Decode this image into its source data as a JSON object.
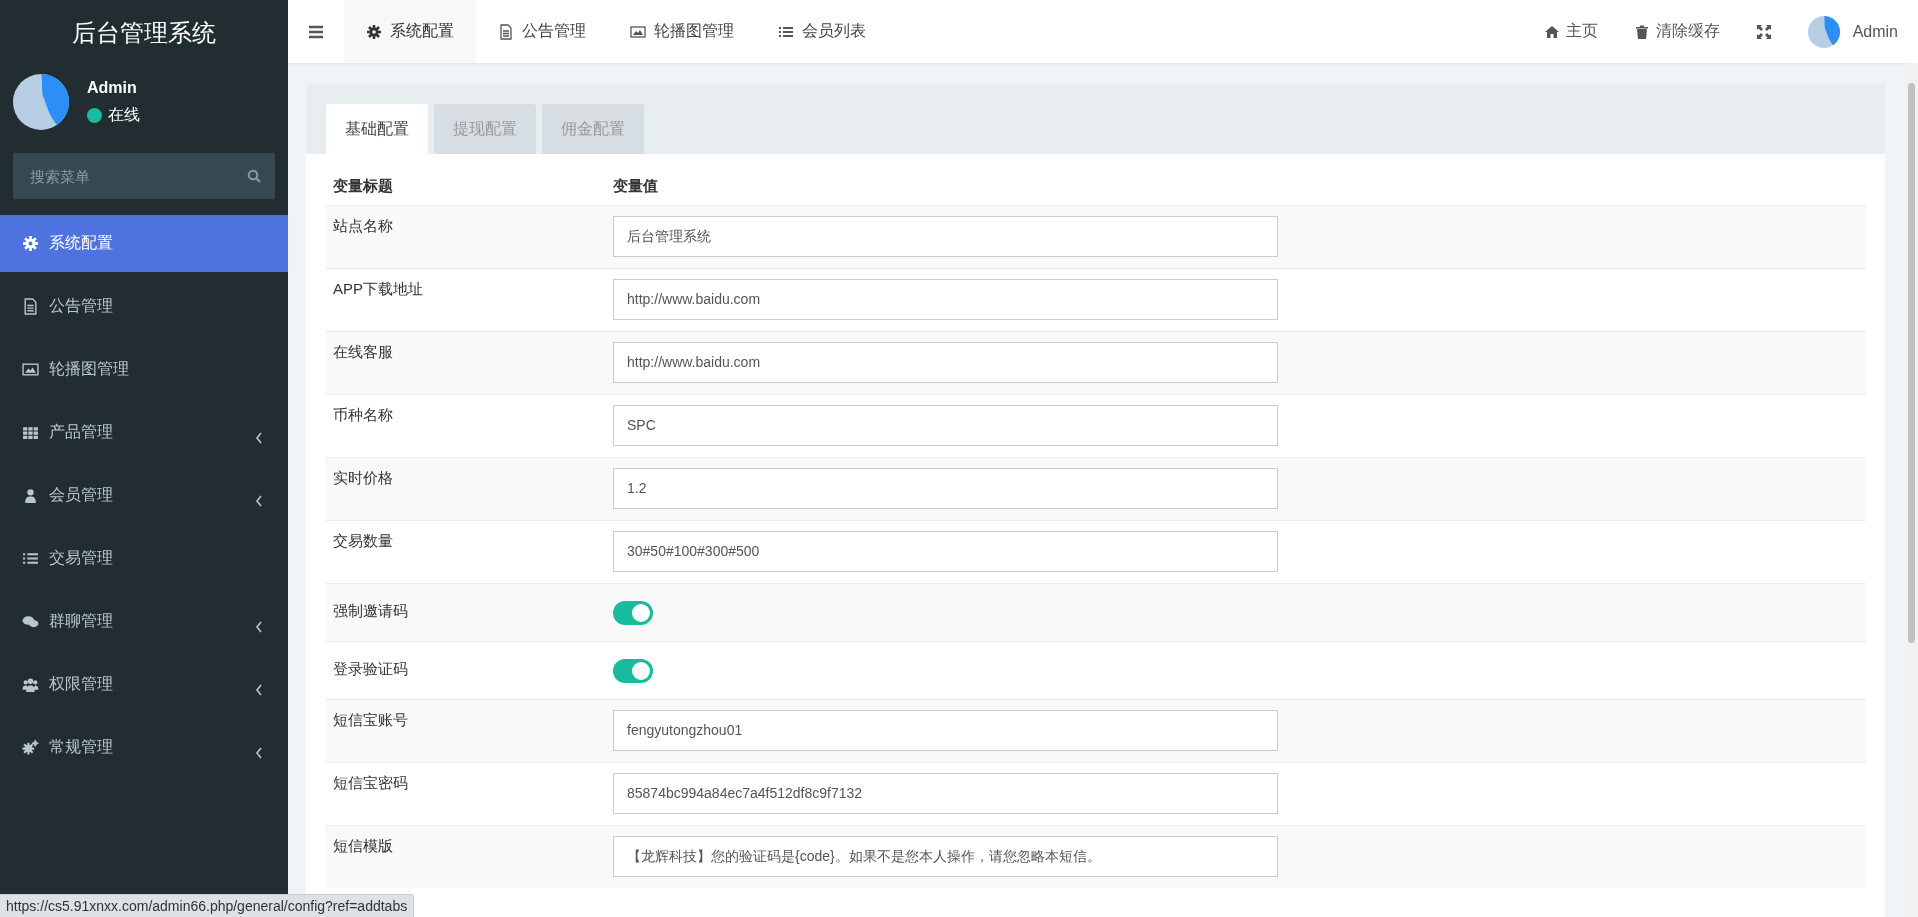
{
  "sidebar": {
    "title": "后台管理系统",
    "user": {
      "name": "Admin",
      "status": "在线"
    },
    "search": {
      "placeholder": "搜索菜单"
    },
    "items": [
      {
        "label": "系统配置",
        "selected": true,
        "has_submenu": false
      },
      {
        "label": "公告管理",
        "selected": false,
        "has_submenu": false
      },
      {
        "label": "轮播图管理",
        "selected": false,
        "has_submenu": false
      },
      {
        "label": "产品管理",
        "selected": false,
        "has_submenu": true
      },
      {
        "label": "会员管理",
        "selected": false,
        "has_submenu": true
      },
      {
        "label": "交易管理",
        "selected": false,
        "has_submenu": false
      },
      {
        "label": "群聊管理",
        "selected": false,
        "has_submenu": true
      },
      {
        "label": "权限管理",
        "selected": false,
        "has_submenu": true
      },
      {
        "label": "常规管理",
        "selected": false,
        "has_submenu": true
      }
    ]
  },
  "top_tabs": [
    {
      "label": "系统配置",
      "selected": true
    },
    {
      "label": "公告管理",
      "selected": false
    },
    {
      "label": "轮播图管理",
      "selected": false
    },
    {
      "label": "会员列表",
      "selected": false
    }
  ],
  "top_right": {
    "home": "主页",
    "clear_cache": "清除缓存",
    "user": "Admin"
  },
  "config_tabs": [
    {
      "label": "基础配置",
      "selected": true
    },
    {
      "label": "提现配置",
      "selected": false
    },
    {
      "label": "佣金配置",
      "selected": false
    }
  ],
  "table": {
    "columns": [
      "变量标题",
      "变量值"
    ],
    "rows": [
      {
        "kind": "text",
        "title": "站点名称",
        "value": "后台管理系统"
      },
      {
        "kind": "text",
        "title": "APP下载地址",
        "value": "http://www.baidu.com"
      },
      {
        "kind": "text",
        "title": "在线客服",
        "value": "http://www.baidu.com"
      },
      {
        "kind": "text",
        "title": "币种名称",
        "value": "SPC"
      },
      {
        "kind": "text",
        "title": "实时价格",
        "value": "1.2"
      },
      {
        "kind": "text",
        "title": "交易数量",
        "value": "30#50#100#300#500"
      },
      {
        "kind": "toggle",
        "title": "强制邀请码",
        "on": true
      },
      {
        "kind": "toggle",
        "title": "登录验证码",
        "on": true
      },
      {
        "kind": "text",
        "title": "短信宝账号",
        "value": "fengyutongzhou01"
      },
      {
        "kind": "text",
        "title": "短信宝密码",
        "value": "85874bc994a84ec7a4f512df8c9f7132"
      },
      {
        "kind": "text",
        "title": "短信模版",
        "value": "【龙辉科技】您的验证码是{code}。如果不是您本人操作，请您忽略本短信。"
      }
    ]
  },
  "status_bar": {
    "url": "https://cs5.91xnxx.com/admin66.php/general/config?ref=addtabs"
  }
}
